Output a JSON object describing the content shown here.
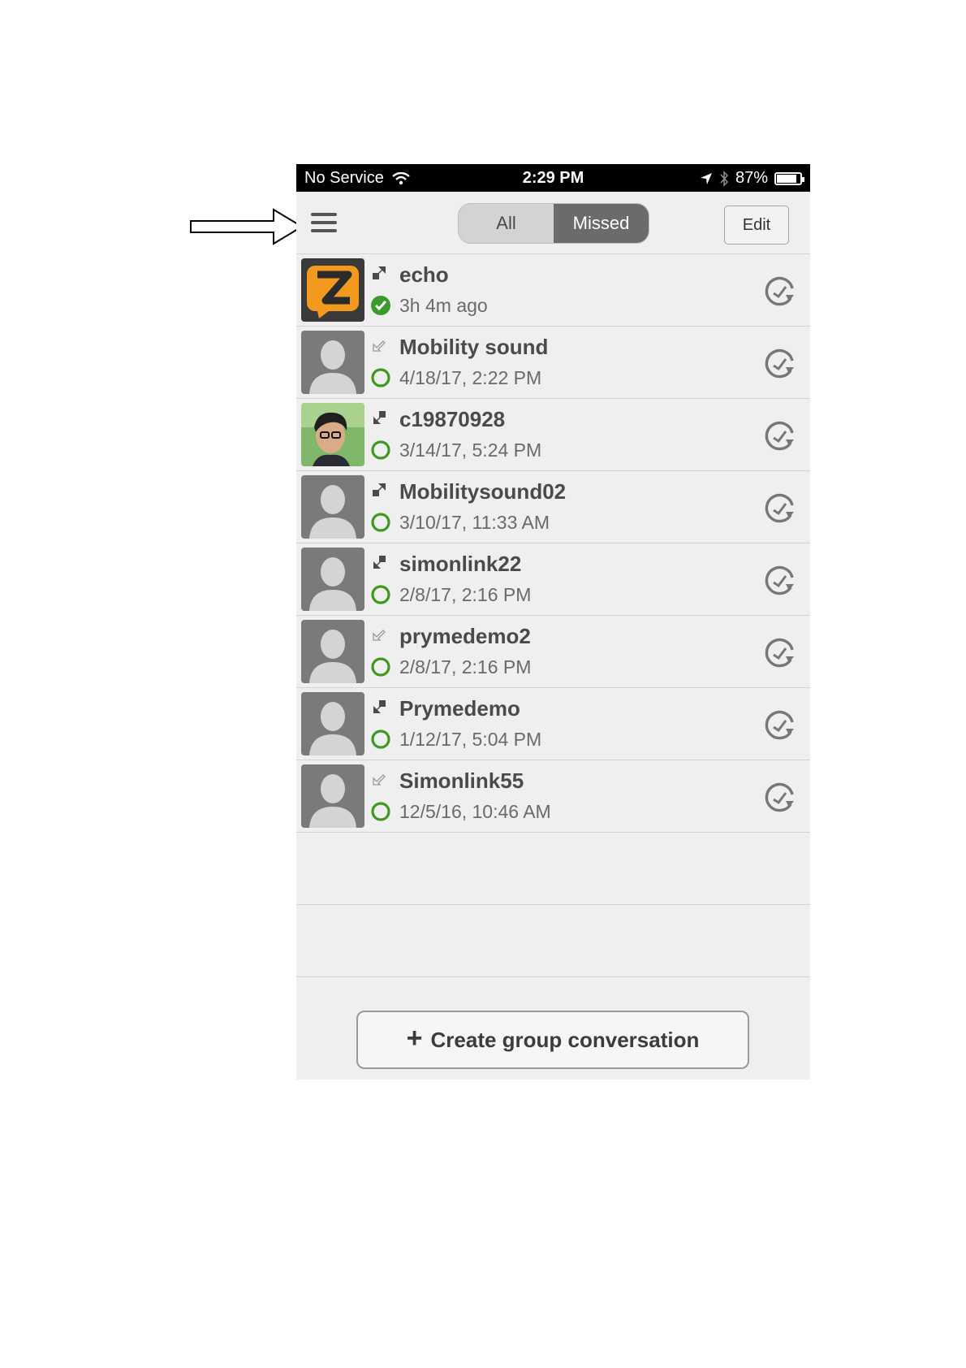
{
  "status_bar": {
    "carrier": "No Service",
    "time": "2:29 PM",
    "battery_percent": "87%",
    "battery_level": 0.87,
    "icons": [
      "wifi-icon",
      "location-arrow-icon",
      "bluetooth-icon",
      "battery-icon"
    ]
  },
  "nav": {
    "menu_icon": "hamburger-menu-icon",
    "tabs": [
      {
        "label": "All",
        "active": false
      },
      {
        "label": "Missed",
        "active": true
      }
    ],
    "edit_label": "Edit"
  },
  "calls": [
    {
      "name": "echo",
      "time": "3h 4m ago",
      "avatar": "zoiper-logo",
      "direction": "outgoing",
      "presence": "online"
    },
    {
      "name": "Mobility sound",
      "time": "4/18/17, 2:22 PM",
      "avatar": "default",
      "direction": "missed",
      "presence": "offline"
    },
    {
      "name": "c19870928",
      "time": "3/14/17, 5:24 PM",
      "avatar": "photo",
      "direction": "incoming",
      "presence": "offline"
    },
    {
      "name": "Mobilitysound02",
      "time": "3/10/17, 11:33 AM",
      "avatar": "default",
      "direction": "outgoing",
      "presence": "offline"
    },
    {
      "name": "simonlink22",
      "time": "2/8/17, 2:16 PM",
      "avatar": "default",
      "direction": "incoming",
      "presence": "offline"
    },
    {
      "name": "prymedemo2",
      "time": "2/8/17, 2:16 PM",
      "avatar": "default",
      "direction": "missed",
      "presence": "offline"
    },
    {
      "name": "Prymedemo",
      "time": "1/12/17, 5:04 PM",
      "avatar": "default",
      "direction": "incoming",
      "presence": "offline"
    },
    {
      "name": "Simonlink55",
      "time": "12/5/16, 10:46 AM",
      "avatar": "default",
      "direction": "missed",
      "presence": "offline"
    }
  ],
  "create_group_label": "Create group conversation",
  "colors": {
    "online_green": "#3a9a2b",
    "offline_ring": "#3e9a1f",
    "zoiper_orange": "#f39a1e",
    "active_tab": "#6b6b6b"
  }
}
